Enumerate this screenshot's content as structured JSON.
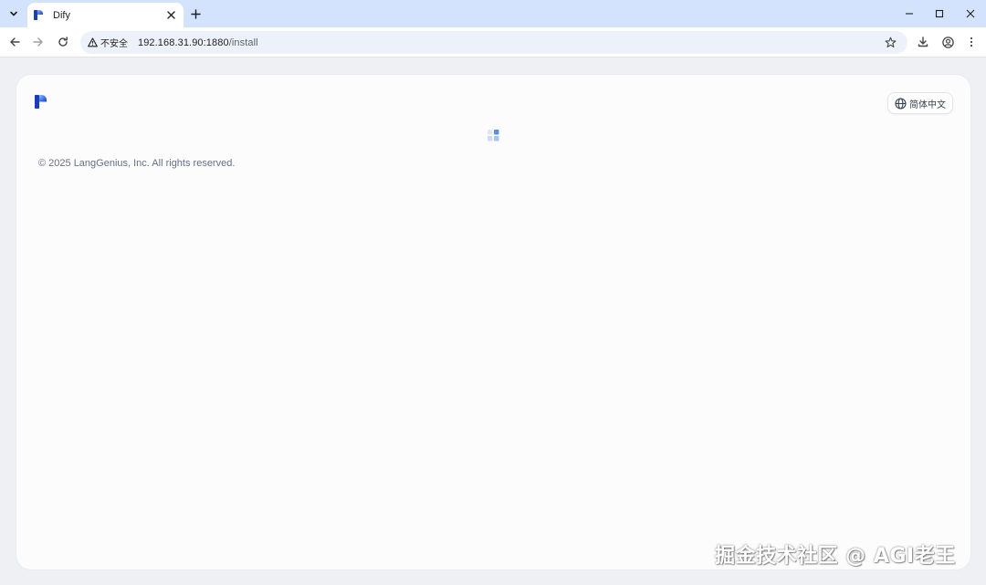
{
  "browser": {
    "tab": {
      "title": "Dify"
    },
    "toolbar": {
      "security_label": "不安全",
      "url_host": "192.168.31.90:1880",
      "url_path": "/install"
    },
    "icons": {
      "tab_search": "chevron-down-icon",
      "tab_close": "close-icon",
      "new_tab": "plus-icon",
      "minimize": "minimize-icon",
      "maximize": "maximize-icon",
      "close_window": "close-icon",
      "back": "arrow-left-icon",
      "forward": "arrow-right-icon",
      "reload": "reload-icon",
      "insecure": "warning-icon",
      "bookmark": "star-icon",
      "downloads": "download-icon",
      "profile": "profile-icon",
      "menu": "more-vertical-icon"
    }
  },
  "page": {
    "language_button": {
      "label": "简体中文",
      "icon": "globe-icon"
    },
    "copyright": "© 2025 LangGenius, Inc. All rights reserved.",
    "loading": "loading-icon"
  },
  "watermark": "掘金技术社区 @ AGI老王",
  "colors": {
    "tabstrip": "#d3e3fd",
    "brand_blue": "#1c64f2",
    "page_bg": "#eef0f4",
    "card_bg": "#fcfcfd"
  }
}
